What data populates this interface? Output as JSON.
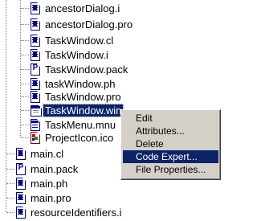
{
  "tree": {
    "nested_items": [
      {
        "label": "ancestorDialog.i",
        "icon": "source-file-icon"
      },
      {
        "label": "ancestorDialog.pro",
        "icon": "source-file-icon"
      },
      {
        "label": "TaskWindow.cl",
        "icon": "source-file-icon"
      },
      {
        "label": "TaskWindow.i",
        "icon": "source-file-icon"
      },
      {
        "label": "TaskWindow.pack",
        "icon": "package-file-icon"
      },
      {
        "label": "taskWindow.ph",
        "icon": "source-file-icon"
      },
      {
        "label": "TaskWindow.pro",
        "icon": "source-file-icon"
      },
      {
        "label": "TaskWindow.win",
        "icon": "window-file-icon",
        "selected": true
      },
      {
        "label": "TaskMenu.mnu",
        "icon": "menu-file-icon"
      },
      {
        "label": "ProjectIcon.ico",
        "icon": "icon-file-icon"
      }
    ],
    "root_items": [
      {
        "label": "main.cl",
        "icon": "source-file-icon"
      },
      {
        "label": "main.pack",
        "icon": "package-file-icon"
      },
      {
        "label": "main.ph",
        "icon": "source-file-icon"
      },
      {
        "label": "main.pro",
        "icon": "source-file-icon"
      },
      {
        "label": "resourceIdentifiers.i",
        "icon": "source-file-icon"
      }
    ],
    "pack_letter": "P"
  },
  "context_menu": {
    "items": [
      {
        "label": "Edit"
      },
      {
        "label": "Attributes..."
      },
      {
        "label": "Delete"
      },
      {
        "label": "Code Expert...",
        "highlighted": true
      },
      {
        "label": "File Properties..."
      }
    ]
  },
  "colors": {
    "selection": "#0a246a",
    "menu_background": "#d4d0c8",
    "tree_lines": "#808080"
  }
}
